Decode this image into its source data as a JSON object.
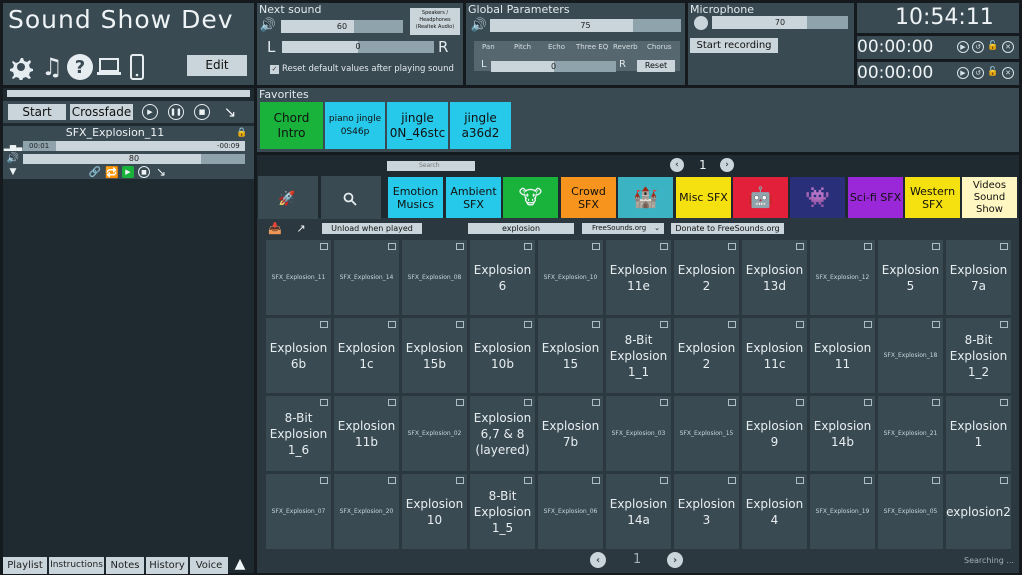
{
  "app": {
    "title": "Sound Show Dev",
    "edit_label": "Edit"
  },
  "colors": {
    "bg": "#141a1d",
    "panel": "#3a4a53",
    "accent_green": "#19b23a",
    "accent_cyan": "#27c9ea"
  },
  "next_sound": {
    "label": "Next sound",
    "volume": "60",
    "balance": "0",
    "left": "L",
    "right": "R",
    "output_line1": "Speakers /",
    "output_line2": "Headphones",
    "output_line3": "(Realtek Audio)",
    "reset_label": "Reset default values after playing sound"
  },
  "global": {
    "label": "Global Parameters",
    "volume": "75",
    "tabs": [
      "Pan",
      "Pitch",
      "Echo",
      "Three EQ",
      "Reverb",
      "Chorus"
    ],
    "left": "L",
    "right": "R",
    "pan_value": "0",
    "reset_label": "Reset"
  },
  "microphone": {
    "label": "Microphone",
    "volume": "70",
    "record_label": "Start recording"
  },
  "clock": {
    "time": "10:54:11",
    "timer1": "00:00:00",
    "timer2": "00:00:00"
  },
  "player": {
    "start_label": "Start",
    "crossfade_label": "Crossfade",
    "track_name": "SFX_Explosion_11",
    "elapsed": "00:01",
    "remaining": "-00:09",
    "volume": "80"
  },
  "bottom_tabs": [
    "Playlist",
    "Instructions",
    "Notes",
    "History",
    "Voice"
  ],
  "favorites": {
    "label": "Favorites",
    "items": [
      {
        "line1": "Chord",
        "line2": "Intro"
      },
      {
        "line1": "piano jingle",
        "line2": "0S46p"
      },
      {
        "line1": "jingle",
        "line2": "0N_46stc"
      },
      {
        "line1": "jingle",
        "line2": "a36d2"
      }
    ]
  },
  "search": {
    "placeholder": "Search",
    "page": "1"
  },
  "categories": [
    {
      "line1": "Emotion",
      "line2": "Musics",
      "line3": ""
    },
    {
      "line1": "Ambient",
      "line2": "SFX",
      "line3": ""
    },
    {
      "line1": "Crowd",
      "line2": "SFX",
      "line3": ""
    },
    {
      "line1": "Misc SFX",
      "line2": "",
      "line3": ""
    },
    {
      "line1": "Sci-fi SFX",
      "line2": "",
      "line3": ""
    },
    {
      "line1": "Western",
      "line2": "SFX",
      "line3": ""
    },
    {
      "line1": "Videos",
      "line2": "Sound",
      "line3": "Show"
    }
  ],
  "freesound": {
    "unload_label": "Unload when played",
    "query": "explosion",
    "source": "FreeSounds.org",
    "donate_label": "Donate to FreeSounds.org",
    "page": "1",
    "status": "Searching ..."
  },
  "grid": [
    [
      "SFX_Explosion_11",
      "SFX_Explosion_14",
      "SFX_Explosion_08",
      "Explosion 6",
      "SFX_Explosion_10",
      "Explosion 11e",
      "Explosion 2",
      "Explosion 13d",
      "SFX_Explosion_12",
      "Explosion 5",
      "Explosion 7a"
    ],
    [
      "Explosion 6b",
      "Explosion 1c",
      "Explosion 15b",
      "Explosion 10b",
      "Explosion 15",
      "8-Bit Explosion 1_1",
      "Explosion 2",
      "Explosion 11c",
      "Explosion 11",
      "SFX_Explosion_18",
      "8-Bit Explosion 1_2"
    ],
    [
      "8-Bit Explosion 1_6",
      "Explosion 11b",
      "SFX_Explosion_02",
      "Explosion 6,7 & 8 (layered)",
      "Explosion 7b",
      "SFX_Explosion_03",
      "SFX_Explosion_15",
      "Explosion 9",
      "Explosion 14b",
      "SFX_Explosion_21",
      "Explosion 1"
    ],
    [
      "SFX_Explosion_07",
      "SFX_Explosion_20",
      "Explosion 10",
      "8-Bit Explosion 1_5",
      "SFX_Explosion_06",
      "Explosion 14a",
      "Explosion 3",
      "Explosion 4",
      "SFX_Explosion_19",
      "SFX_Explosion_05",
      "explosion2"
    ]
  ]
}
